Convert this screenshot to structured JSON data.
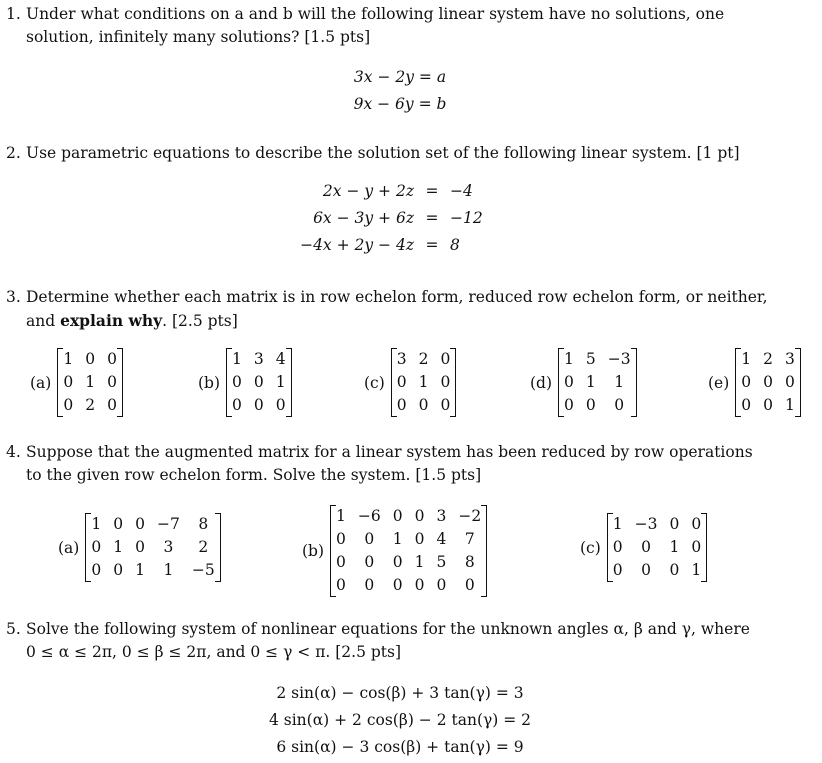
{
  "questions": [
    {
      "number": "1.",
      "text_line1": "Under what conditions on a and b will the following linear system have no solutions, one",
      "text_line2": "solution, infinitely many solutions? [1.5 pts]",
      "equations": [
        "3x − 2y = a",
        "9x − 6y = b"
      ]
    },
    {
      "number": "2.",
      "text": "Use parametric equations to describe the solution set of the following linear system. [1 pt]",
      "equations": [
        {
          "lhs": "2x − y + 2z",
          "eq": "=",
          "rhs": "−4"
        },
        {
          "lhs": "6x − 3y + 6z",
          "eq": "=",
          "rhs": "−12"
        },
        {
          "lhs": "−4x + 2y − 4z",
          "eq": "=",
          "rhs": "8"
        }
      ]
    },
    {
      "number": "3.",
      "text_line1": "Determine whether each matrix is in row echelon form, reduced row echelon form, or neither,",
      "text_line2_pre": "and ",
      "text_line2_bold": "explain why",
      "text_line2_post": ". [2.5 pts]",
      "matrices": [
        {
          "label": "(a)",
          "rows": [
            [
              "1",
              "0",
              "0"
            ],
            [
              "0",
              "1",
              "0"
            ],
            [
              "0",
              "2",
              "0"
            ]
          ]
        },
        {
          "label": "(b)",
          "rows": [
            [
              "1",
              "3",
              "4"
            ],
            [
              "0",
              "0",
              "1"
            ],
            [
              "0",
              "0",
              "0"
            ]
          ]
        },
        {
          "label": "(c)",
          "rows": [
            [
              "3",
              "2",
              "0"
            ],
            [
              "0",
              "1",
              "0"
            ],
            [
              "0",
              "0",
              "0"
            ]
          ]
        },
        {
          "label": "(d)",
          "rows": [
            [
              "1",
              "5",
              "−3"
            ],
            [
              "0",
              "1",
              "1"
            ],
            [
              "0",
              "0",
              "0"
            ]
          ]
        },
        {
          "label": "(e)",
          "rows": [
            [
              "1",
              "2",
              "3"
            ],
            [
              "0",
              "0",
              "0"
            ],
            [
              "0",
              "0",
              "1"
            ]
          ]
        }
      ]
    },
    {
      "number": "4.",
      "text_line1": "Suppose that the augmented matrix for a linear system has been reduced by row operations",
      "text_line2": "to the given row echelon form. Solve the system. [1.5 pts]",
      "matrices": [
        {
          "label": "(a)",
          "rows": [
            [
              "1",
              "0",
              "0",
              "−7",
              "8"
            ],
            [
              "0",
              "1",
              "0",
              "3",
              "2"
            ],
            [
              "0",
              "0",
              "1",
              "1",
              "−5"
            ]
          ]
        },
        {
          "label": "(b)",
          "rows": [
            [
              "1",
              "−6",
              "0",
              "0",
              "3",
              "−2"
            ],
            [
              "0",
              "0",
              "1",
              "0",
              "4",
              "7"
            ],
            [
              "0",
              "0",
              "0",
              "1",
              "5",
              "8"
            ],
            [
              "0",
              "0",
              "0",
              "0",
              "0",
              "0"
            ]
          ]
        },
        {
          "label": "(c)",
          "rows": [
            [
              "1",
              "−3",
              "0",
              "0"
            ],
            [
              "0",
              "0",
              "1",
              "0"
            ],
            [
              "0",
              "0",
              "0",
              "1"
            ]
          ]
        }
      ]
    },
    {
      "number": "5.",
      "text_line1": "Solve the following system of nonlinear equations for the unknown angles α, β and γ, where",
      "text_line2": "0 ≤ α ≤ 2π, 0 ≤ β ≤ 2π, and 0 ≤ γ < π. [2.5 pts]",
      "equations": [
        "2 sin(α) − cos(β) + 3 tan(γ) = 3",
        "4 sin(α) + 2 cos(β) − 2 tan(γ) = 2",
        "6 sin(α) − 3 cos(β) + tan(γ) = 9"
      ]
    }
  ]
}
